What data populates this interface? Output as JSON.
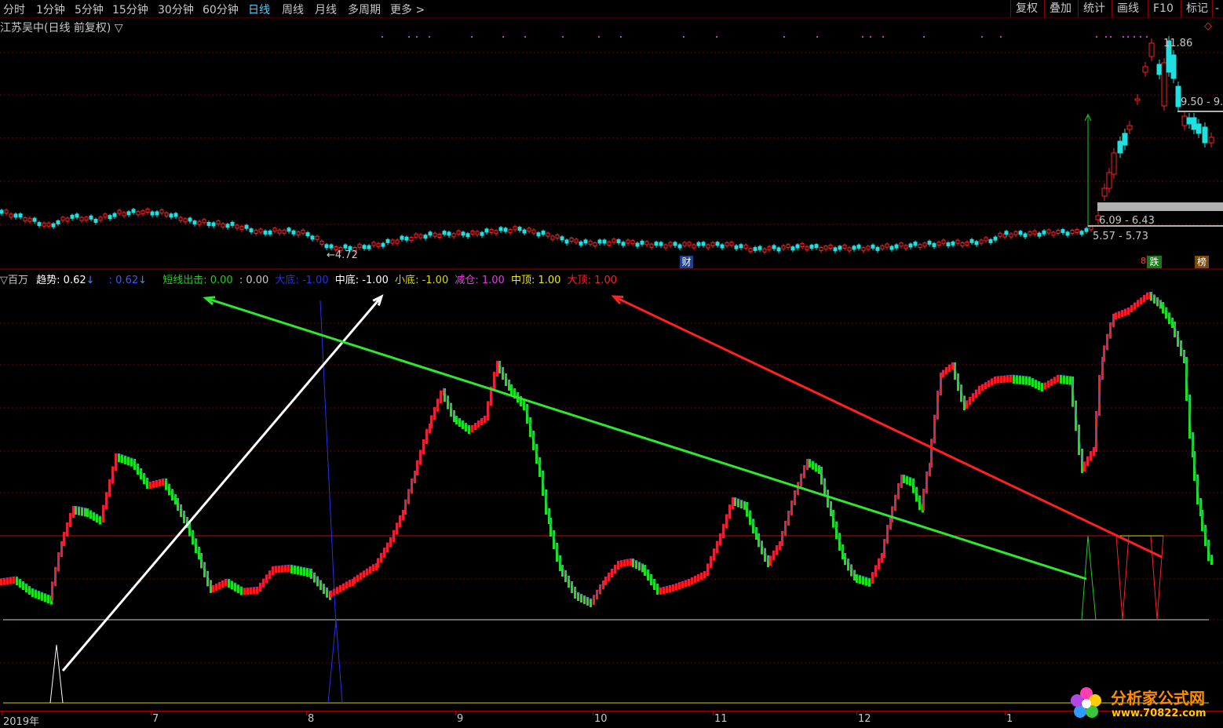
{
  "toolbar": {
    "tabs": [
      {
        "label": "分时",
        "active": false
      },
      {
        "label": "1分钟",
        "active": false
      },
      {
        "label": "5分钟",
        "active": false
      },
      {
        "label": "15分钟",
        "active": false
      },
      {
        "label": "30分钟",
        "active": false
      },
      {
        "label": "60分钟",
        "active": false
      },
      {
        "label": "日线",
        "active": true
      },
      {
        "label": "周线",
        "active": false
      },
      {
        "label": "月线",
        "active": false
      },
      {
        "label": "多周期",
        "active": false
      },
      {
        "label": "更多 >",
        "active": false
      }
    ],
    "right_buttons": [
      "复权",
      "叠加",
      "统计",
      "画线",
      "F10",
      "标记",
      "-"
    ]
  },
  "main_chart": {
    "title": "江苏吴中(日线 前复权) ▽",
    "high_label": "11.86",
    "low_label": "←4.72",
    "range_top_label": "9.50 - 9.",
    "range_mid_label": "6.09 - 6.43",
    "range_low_label": "5.57 - 5.73",
    "cai_badge": "财",
    "tag_down": "跌",
    "tag_bang": "榜",
    "tag_small": "8"
  },
  "indicator": {
    "name": "▽百万",
    "items": [
      {
        "label": "趋势",
        "value": ": 0.62",
        "arrow": "↓",
        "color": "#ffffff"
      },
      {
        "label": "",
        "value": ": 0.62",
        "arrow": "↓",
        "color": "#3a5bff"
      },
      {
        "label": "短线出击",
        "value": ": 0.00",
        "color": "#22cc22"
      },
      {
        "label": "",
        "value": ": 0.00",
        "color": "#c8c8c8"
      },
      {
        "label": "大底",
        "value": ": -1.00",
        "color": "#2233ee"
      },
      {
        "label": "中底",
        "value": ": -1.00",
        "color": "#ffffff"
      },
      {
        "label": "小底",
        "value": ": -1.00",
        "color": "#dddd00"
      },
      {
        "label": "减仓",
        "value": ": 1.00",
        "color": "#e040e0"
      },
      {
        "label": "中顶",
        "value": ": 1.00",
        "color": "#eeee00"
      },
      {
        "label": "大顶",
        "value": ": 1.00",
        "color": "#ff2020"
      }
    ]
  },
  "x_axis": {
    "ticks": [
      "2019年",
      "7",
      "8",
      "9",
      "10",
      "11",
      "12",
      "1"
    ]
  },
  "watermark": {
    "text": "分析家公式网",
    "url": "www.70822.com"
  },
  "colors": {
    "up": "#ff2020",
    "down": "#20e0e0",
    "osc_up": "#ff1a1a",
    "osc_down": "#1ee01e",
    "grid": "#7a0000",
    "active_tab": "#4fd0ff"
  }
}
